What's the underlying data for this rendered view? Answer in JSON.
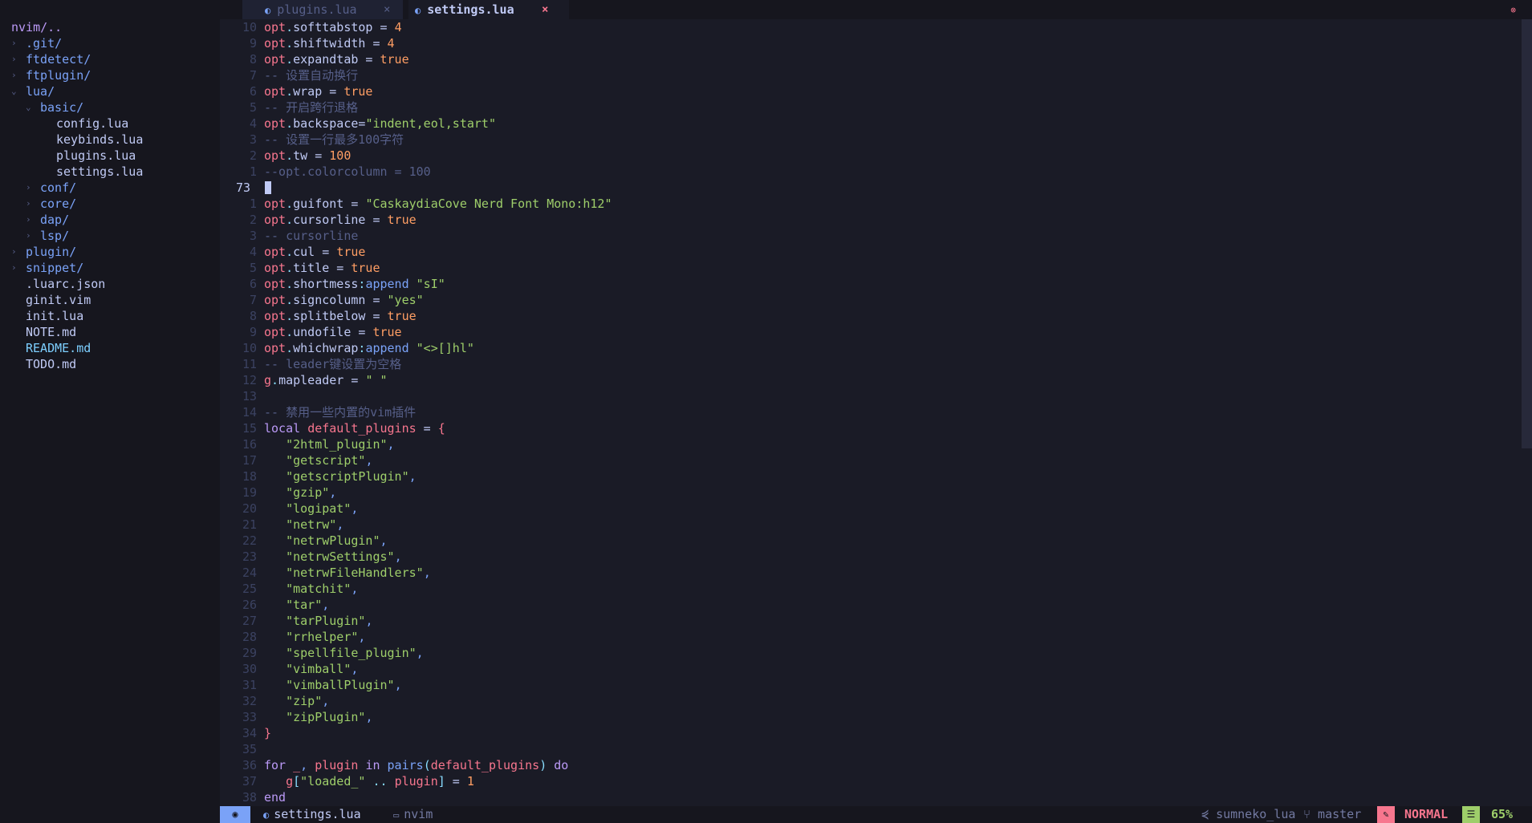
{
  "tabs": [
    {
      "label": "plugins.lua",
      "icon": "lua-icon",
      "close": "×",
      "active": false
    },
    {
      "label": "settings.lua",
      "icon": "lua-icon",
      "close": "×",
      "active": true
    }
  ],
  "tab_indicator": "⊗",
  "explorer": {
    "root": "nvim/..",
    "items": [
      {
        "name": ".git/",
        "type": "dir",
        "expanded": false,
        "depth": 0
      },
      {
        "name": "ftdetect/",
        "type": "dir",
        "expanded": false,
        "depth": 0
      },
      {
        "name": "ftplugin/",
        "type": "dir",
        "expanded": false,
        "depth": 0
      },
      {
        "name": "lua/",
        "type": "dir",
        "expanded": true,
        "depth": 0
      },
      {
        "name": "basic/",
        "type": "dir",
        "expanded": true,
        "depth": 1
      },
      {
        "name": "config.lua",
        "type": "file",
        "depth": 2
      },
      {
        "name": "keybinds.lua",
        "type": "file",
        "depth": 2
      },
      {
        "name": "plugins.lua",
        "type": "file",
        "depth": 2
      },
      {
        "name": "settings.lua",
        "type": "file",
        "depth": 2
      },
      {
        "name": "conf/",
        "type": "dir",
        "expanded": false,
        "depth": 1
      },
      {
        "name": "core/",
        "type": "dir",
        "expanded": false,
        "depth": 1
      },
      {
        "name": "dap/",
        "type": "dir",
        "expanded": false,
        "depth": 1
      },
      {
        "name": "lsp/",
        "type": "dir",
        "expanded": false,
        "depth": 1
      },
      {
        "name": "plugin/",
        "type": "dir",
        "expanded": false,
        "depth": 0
      },
      {
        "name": "snippet/",
        "type": "dir",
        "expanded": false,
        "depth": 0
      },
      {
        "name": ".luarc.json",
        "type": "file",
        "depth": 0
      },
      {
        "name": "ginit.vim",
        "type": "file",
        "depth": 0
      },
      {
        "name": "init.lua",
        "type": "file",
        "depth": 0
      },
      {
        "name": "NOTE.md",
        "type": "file",
        "depth": 0
      },
      {
        "name": "README.md",
        "type": "md",
        "depth": 0
      },
      {
        "name": "TODO.md",
        "type": "file",
        "depth": 0
      }
    ]
  },
  "editor": {
    "lines": [
      {
        "n": "10",
        "cur": false,
        "tokens": [
          [
            "opt",
            "opt"
          ],
          [
            "op",
            "."
          ],
          [
            "var",
            "softtabstop = "
          ],
          [
            "num",
            "4"
          ]
        ]
      },
      {
        "n": "9",
        "cur": false,
        "tokens": [
          [
            "opt",
            "opt"
          ],
          [
            "op",
            "."
          ],
          [
            "var",
            "shiftwidth = "
          ],
          [
            "num",
            "4"
          ]
        ]
      },
      {
        "n": "8",
        "cur": false,
        "tokens": [
          [
            "opt",
            "opt"
          ],
          [
            "op",
            "."
          ],
          [
            "var",
            "expandtab = "
          ],
          [
            "bool",
            "true"
          ]
        ]
      },
      {
        "n": "7",
        "cur": false,
        "tokens": [
          [
            "com",
            "-- 设置自动换行"
          ]
        ]
      },
      {
        "n": "6",
        "cur": false,
        "tokens": [
          [
            "opt",
            "opt"
          ],
          [
            "op",
            "."
          ],
          [
            "var",
            "wrap = "
          ],
          [
            "bool",
            "true"
          ]
        ]
      },
      {
        "n": "5",
        "cur": false,
        "tokens": [
          [
            "com",
            "-- 开启跨行退格"
          ]
        ]
      },
      {
        "n": "4",
        "cur": false,
        "tokens": [
          [
            "opt",
            "opt"
          ],
          [
            "op",
            "."
          ],
          [
            "var",
            "backspace="
          ],
          [
            "str",
            "\"indent,eol,start\""
          ]
        ]
      },
      {
        "n": "3",
        "cur": false,
        "tokens": [
          [
            "com",
            "-- 设置一行最多100字符"
          ]
        ]
      },
      {
        "n": "2",
        "cur": false,
        "tokens": [
          [
            "opt",
            "opt"
          ],
          [
            "op",
            "."
          ],
          [
            "var",
            "tw = "
          ],
          [
            "num",
            "100"
          ]
        ]
      },
      {
        "n": "1",
        "cur": false,
        "tokens": [
          [
            "com",
            "--opt.colorcolumn = 100"
          ]
        ]
      },
      {
        "n": "73",
        "cur": true,
        "tokens": []
      },
      {
        "n": "1",
        "cur": false,
        "tokens": [
          [
            "opt",
            "opt"
          ],
          [
            "op",
            "."
          ],
          [
            "var",
            "guifont = "
          ],
          [
            "str",
            "\"CaskaydiaCove Nerd Font Mono:h12\""
          ]
        ]
      },
      {
        "n": "2",
        "cur": false,
        "tokens": [
          [
            "opt",
            "opt"
          ],
          [
            "op",
            "."
          ],
          [
            "var",
            "cursorline = "
          ],
          [
            "bool",
            "true"
          ]
        ]
      },
      {
        "n": "3",
        "cur": false,
        "tokens": [
          [
            "com",
            "-- cursorline"
          ]
        ]
      },
      {
        "n": "4",
        "cur": false,
        "tokens": [
          [
            "opt",
            "opt"
          ],
          [
            "op",
            "."
          ],
          [
            "var",
            "cul = "
          ],
          [
            "bool",
            "true"
          ]
        ]
      },
      {
        "n": "5",
        "cur": false,
        "tokens": [
          [
            "opt",
            "opt"
          ],
          [
            "op",
            "."
          ],
          [
            "var",
            "title = "
          ],
          [
            "bool",
            "true"
          ]
        ]
      },
      {
        "n": "6",
        "cur": false,
        "tokens": [
          [
            "opt",
            "opt"
          ],
          [
            "op",
            "."
          ],
          [
            "var",
            "shortmess"
          ],
          [
            "op",
            ":"
          ],
          [
            "fn",
            "append "
          ],
          [
            "str",
            "\"sI\""
          ]
        ]
      },
      {
        "n": "7",
        "cur": false,
        "tokens": [
          [
            "opt",
            "opt"
          ],
          [
            "op",
            "."
          ],
          [
            "var",
            "signcolumn = "
          ],
          [
            "str",
            "\"yes\""
          ]
        ]
      },
      {
        "n": "8",
        "cur": false,
        "tokens": [
          [
            "opt",
            "opt"
          ],
          [
            "op",
            "."
          ],
          [
            "var",
            "splitbelow = "
          ],
          [
            "bool",
            "true"
          ]
        ]
      },
      {
        "n": "9",
        "cur": false,
        "tokens": [
          [
            "opt",
            "opt"
          ],
          [
            "op",
            "."
          ],
          [
            "var",
            "undofile = "
          ],
          [
            "bool",
            "true"
          ]
        ]
      },
      {
        "n": "10",
        "cur": false,
        "tokens": [
          [
            "opt",
            "opt"
          ],
          [
            "op",
            "."
          ],
          [
            "var",
            "whichwrap"
          ],
          [
            "op",
            ":"
          ],
          [
            "fn",
            "append "
          ],
          [
            "str",
            "\"<>[]hl\""
          ]
        ]
      },
      {
        "n": "11",
        "cur": false,
        "tokens": [
          [
            "com",
            "-- leader键设置为空格"
          ]
        ]
      },
      {
        "n": "12",
        "cur": false,
        "tokens": [
          [
            "opt",
            "g"
          ],
          [
            "op",
            "."
          ],
          [
            "var",
            "mapleader = "
          ],
          [
            "str",
            "\" \""
          ]
        ]
      },
      {
        "n": "13",
        "cur": false,
        "tokens": []
      },
      {
        "n": "14",
        "cur": false,
        "tokens": [
          [
            "com",
            "-- 禁用一些内置的vim插件"
          ]
        ]
      },
      {
        "n": "15",
        "cur": false,
        "tokens": [
          [
            "kw",
            "local "
          ],
          [
            "opt",
            "default_plugins"
          ],
          [
            "var",
            " = "
          ],
          [
            "brace",
            "{"
          ]
        ]
      },
      {
        "n": "16",
        "cur": false,
        "tokens": [
          [
            "var",
            "   "
          ],
          [
            "str",
            "\"2html_plugin\""
          ],
          [
            "punc",
            ","
          ]
        ]
      },
      {
        "n": "17",
        "cur": false,
        "tokens": [
          [
            "var",
            "   "
          ],
          [
            "str",
            "\"getscript\""
          ],
          [
            "punc",
            ","
          ]
        ]
      },
      {
        "n": "18",
        "cur": false,
        "tokens": [
          [
            "var",
            "   "
          ],
          [
            "str",
            "\"getscriptPlugin\""
          ],
          [
            "punc",
            ","
          ]
        ]
      },
      {
        "n": "19",
        "cur": false,
        "tokens": [
          [
            "var",
            "   "
          ],
          [
            "str",
            "\"gzip\""
          ],
          [
            "punc",
            ","
          ]
        ]
      },
      {
        "n": "20",
        "cur": false,
        "tokens": [
          [
            "var",
            "   "
          ],
          [
            "str",
            "\"logipat\""
          ],
          [
            "punc",
            ","
          ]
        ]
      },
      {
        "n": "21",
        "cur": false,
        "tokens": [
          [
            "var",
            "   "
          ],
          [
            "str",
            "\"netrw\""
          ],
          [
            "punc",
            ","
          ]
        ]
      },
      {
        "n": "22",
        "cur": false,
        "tokens": [
          [
            "var",
            "   "
          ],
          [
            "str",
            "\"netrwPlugin\""
          ],
          [
            "punc",
            ","
          ]
        ]
      },
      {
        "n": "23",
        "cur": false,
        "tokens": [
          [
            "var",
            "   "
          ],
          [
            "str",
            "\"netrwSettings\""
          ],
          [
            "punc",
            ","
          ]
        ]
      },
      {
        "n": "24",
        "cur": false,
        "tokens": [
          [
            "var",
            "   "
          ],
          [
            "str",
            "\"netrwFileHandlers\""
          ],
          [
            "punc",
            ","
          ]
        ]
      },
      {
        "n": "25",
        "cur": false,
        "tokens": [
          [
            "var",
            "   "
          ],
          [
            "str",
            "\"matchit\""
          ],
          [
            "punc",
            ","
          ]
        ]
      },
      {
        "n": "26",
        "cur": false,
        "tokens": [
          [
            "var",
            "   "
          ],
          [
            "str",
            "\"tar\""
          ],
          [
            "punc",
            ","
          ]
        ]
      },
      {
        "n": "27",
        "cur": false,
        "tokens": [
          [
            "var",
            "   "
          ],
          [
            "str",
            "\"tarPlugin\""
          ],
          [
            "punc",
            ","
          ]
        ]
      },
      {
        "n": "28",
        "cur": false,
        "tokens": [
          [
            "var",
            "   "
          ],
          [
            "str",
            "\"rrhelper\""
          ],
          [
            "punc",
            ","
          ]
        ]
      },
      {
        "n": "29",
        "cur": false,
        "tokens": [
          [
            "var",
            "   "
          ],
          [
            "str",
            "\"spellfile_plugin\""
          ],
          [
            "punc",
            ","
          ]
        ]
      },
      {
        "n": "30",
        "cur": false,
        "tokens": [
          [
            "var",
            "   "
          ],
          [
            "str",
            "\"vimball\""
          ],
          [
            "punc",
            ","
          ]
        ]
      },
      {
        "n": "31",
        "cur": false,
        "tokens": [
          [
            "var",
            "   "
          ],
          [
            "str",
            "\"vimballPlugin\""
          ],
          [
            "punc",
            ","
          ]
        ]
      },
      {
        "n": "32",
        "cur": false,
        "tokens": [
          [
            "var",
            "   "
          ],
          [
            "str",
            "\"zip\""
          ],
          [
            "punc",
            ","
          ]
        ]
      },
      {
        "n": "33",
        "cur": false,
        "tokens": [
          [
            "var",
            "   "
          ],
          [
            "str",
            "\"zipPlugin\""
          ],
          [
            "punc",
            ","
          ]
        ]
      },
      {
        "n": "34",
        "cur": false,
        "tokens": [
          [
            "brace",
            "}"
          ]
        ]
      },
      {
        "n": "35",
        "cur": false,
        "tokens": []
      },
      {
        "n": "36",
        "cur": false,
        "tokens": [
          [
            "kw",
            "for "
          ],
          [
            "opt",
            "_"
          ],
          [
            "punc",
            ", "
          ],
          [
            "opt",
            "plugin "
          ],
          [
            "kw",
            "in "
          ],
          [
            "fn",
            "pairs"
          ],
          [
            "op",
            "("
          ],
          [
            "opt",
            "default_plugins"
          ],
          [
            "op",
            ") "
          ],
          [
            "kw",
            "do"
          ]
        ]
      },
      {
        "n": "37",
        "cur": false,
        "tokens": [
          [
            "var",
            "   "
          ],
          [
            "opt",
            "g"
          ],
          [
            "op",
            "["
          ],
          [
            "str",
            "\"loaded_\""
          ],
          [
            "op",
            " .. "
          ],
          [
            "opt",
            "plugin"
          ],
          [
            "op",
            "]"
          ],
          [
            "var",
            " = "
          ],
          [
            "num",
            "1"
          ]
        ]
      },
      {
        "n": "38",
        "cur": false,
        "tokens": [
          [
            "kw",
            "end"
          ]
        ]
      }
    ]
  },
  "statusline": {
    "mode_left_icon": "◉",
    "file_icon": "◐",
    "file": "settings.lua",
    "dir_icon": "▭",
    "dir": "nvim",
    "lsp_icon": "⋞",
    "lsp": "sumneko_lua",
    "branch_icon": "⑂",
    "branch": "master",
    "mode_icon": "✎",
    "mode": "NORMAL",
    "pos_icon": "☰",
    "percent": "65%"
  },
  "colors": {
    "background": "#1a1b26",
    "sidebar": "#16161e",
    "accent": "#7aa2f7",
    "keyword": "#bb9af7",
    "string": "#9ece6a",
    "number": "#ff9e64",
    "field": "#f7768e",
    "comment": "#565f89"
  }
}
